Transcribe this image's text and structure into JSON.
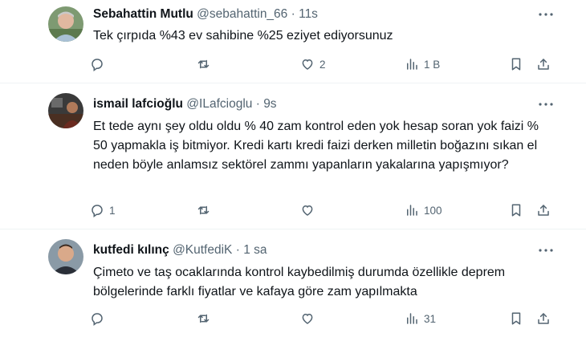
{
  "tweets": [
    {
      "name": "Sebahattin Mutlu",
      "handle": "@sebahattin_66",
      "separator": "·",
      "time": "11s",
      "text": "Tek çırpıda %43 ev sahibine %25 eziyet ediyorsunuz",
      "replies": "",
      "retweets": "",
      "likes": "2",
      "views": "1 B"
    },
    {
      "name": "ismail lafcioğlu",
      "handle": "@ILafcioglu",
      "separator": "·",
      "time": "9s",
      "text": "Et tede aynı şey oldu oldu % 40 zam kontrol eden yok hesap soran yok faizi % 50 yapmakla iş bitmiyor. Kredi kartı kredi faizi derken milletin boğazını sıkan el neden böyle anlamsız sektörel zammı yapanların yakalarına yapışmıyor?",
      "replies": "1",
      "retweets": "",
      "likes": "",
      "views": "100"
    },
    {
      "name": "kutfedi kılınç",
      "handle": "@KutfediK",
      "separator": "·",
      "time": "1 sa",
      "text": "Çimeto ve taş ocaklarında kontrol kaybedilmiş durumda özellikle deprem bölgelerinde farklı fiyatlar ve kafaya göre zam yapılmakta",
      "replies": "",
      "retweets": "",
      "likes": "",
      "views": "31"
    }
  ],
  "icons": {
    "reply": "reply-icon",
    "retweet": "retweet-icon",
    "like": "heart-icon",
    "views": "views-icon",
    "bookmark": "bookmark-icon",
    "share": "share-icon",
    "more": "more-icon"
  },
  "colors": {
    "text": "#0f1419",
    "secondary": "#536471",
    "divider": "#eff3f4"
  }
}
